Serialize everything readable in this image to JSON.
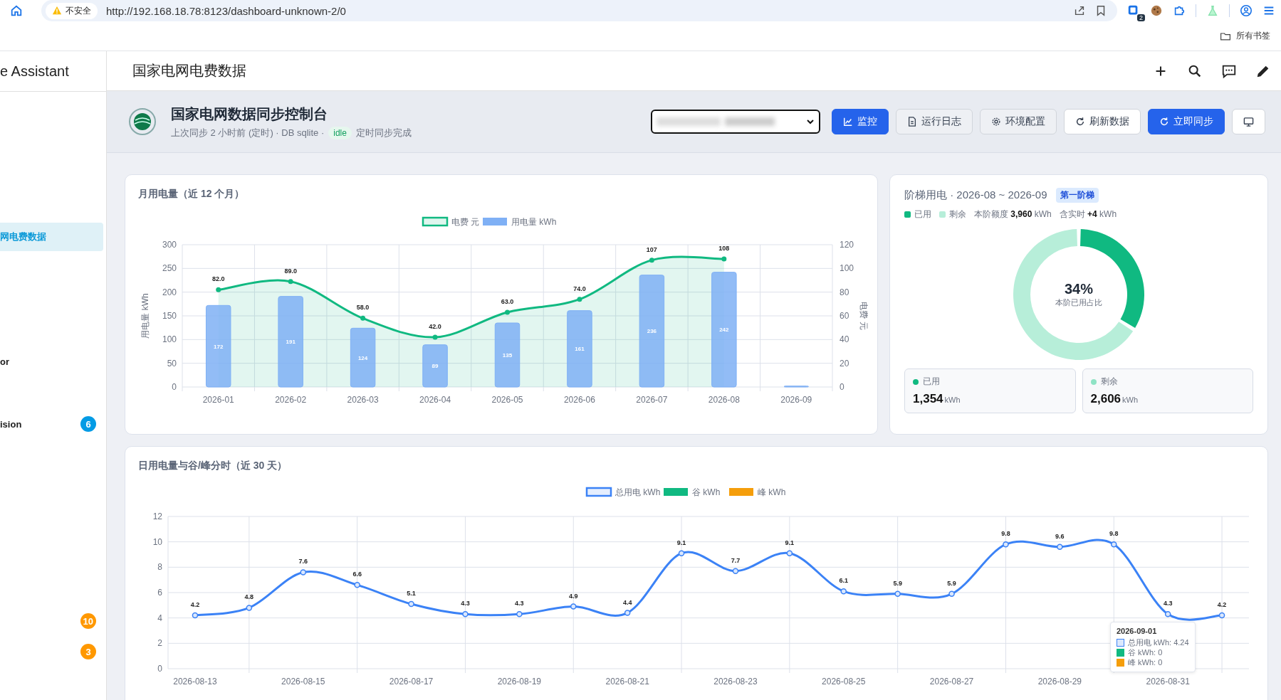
{
  "browser": {
    "security_label": "不安全",
    "url": "http://192.168.18.78:8123/dashboard-unknown-2/0",
    "extension_badge": "2",
    "bookmarks_label": "所有书签"
  },
  "sidebar": {
    "title": "e Assistant",
    "items": [
      {
        "label": "网电费数据",
        "selected": true
      },
      {
        "label": "or",
        "selected": false
      },
      {
        "label": "ision",
        "selected": false,
        "badge": "6",
        "color": "#039be5"
      },
      {
        "selected": false,
        "badge": "10",
        "color": "#ff9800"
      },
      {
        "selected": false,
        "badge": "3",
        "color": "#ff9800"
      }
    ]
  },
  "header": {
    "title": "国家电网电费数据"
  },
  "sync_panel": {
    "title": "国家电网数据同步控制台",
    "subtitle": "上次同步 2 小时前 (定时) · DB sqlite ·",
    "status": "idle",
    "status_text": "定时同步完成",
    "buttons": [
      {
        "label": "监控",
        "kind": "primary"
      },
      {
        "label": "运行日志",
        "kind": "muted"
      },
      {
        "label": "环境配置",
        "kind": "muted"
      },
      {
        "label": "刷新数据",
        "kind": "plain"
      },
      {
        "label": "立即同步",
        "kind": "primary"
      },
      {
        "kind": "plain"
      }
    ]
  },
  "monthly": {
    "title": "月用电量（近 12 个月）",
    "chart_data": {
      "type": "bar",
      "categories": [
        "2026-01",
        "2026-02",
        "2026-03",
        "2026-04",
        "2026-05",
        "2026-06",
        "2026-07",
        "2026-08",
        "2026-09"
      ],
      "series": [
        {
          "name": "电费 元",
          "color": "#10b981",
          "type": "area",
          "marker": true,
          "axis": "y2",
          "values": [
            82,
            89,
            58,
            42,
            63,
            74,
            107,
            108,
            null
          ],
          "value_labels": [
            "82.0",
            "89.0",
            "58.0",
            "42.0",
            "63.0",
            "74.0",
            "107",
            "108",
            null
          ]
        },
        {
          "name": "用电量 kWh",
          "color": "#7fb0f5",
          "type": "bar",
          "values": [
            172,
            191,
            124,
            89,
            135,
            161,
            236,
            242,
            2
          ],
          "value_labels": [
            "172",
            "191",
            "124",
            "89",
            "135",
            "161",
            "236",
            "242",
            null
          ]
        }
      ],
      "grid": true,
      "legend": "top",
      "ylabel": "用电量 kWh",
      "y2label": "电费 元",
      "ylim": [
        0,
        300
      ],
      "y2lim": [
        0,
        120
      ],
      "yticks": [
        0,
        50,
        100,
        150,
        200,
        250,
        300
      ],
      "y2ticks": [
        0,
        20,
        40,
        60,
        80,
        100,
        120
      ]
    }
  },
  "tier": {
    "title": "阶梯用电 · 2026-08 ~ 2026-09",
    "badge": "第一阶梯",
    "quota_text": "本阶额度 **3,960** kWh",
    "realtime_text": "含实时 **+4** kWh",
    "chart_data": {
      "type": "donut",
      "categories": [
        "已用",
        "剩余"
      ],
      "values": [
        34,
        66
      ],
      "colors": [
        "#10b981",
        "#b7eed9"
      ]
    },
    "center_value": "34%",
    "center_label": "本阶已用占比",
    "stats": [
      {
        "label": "已用",
        "value": "1,354",
        "unit": "kWh",
        "color": "#10b981"
      },
      {
        "label": "剩余",
        "value": "2,606",
        "unit": "kWh",
        "color": "#8fe3c5"
      }
    ]
  },
  "daily": {
    "title": "日用电量与谷/峰分时（近 30 天）",
    "chart_data": {
      "type": "line",
      "categories": [
        "2026-08-13",
        null,
        "2026-08-15",
        null,
        "2026-08-17",
        null,
        "2026-08-19",
        null,
        "2026-08-21",
        null,
        "2026-08-23",
        null,
        "2026-08-25",
        null,
        "2026-08-27",
        null,
        "2026-08-29",
        null,
        "2026-08-31",
        null
      ],
      "grid": true,
      "legend": "top",
      "series": [
        {
          "name": "总用电 kWh",
          "color": "#3b82f6",
          "marker": true,
          "values": [
            4.2,
            4.8,
            7.6,
            6.6,
            5.1,
            4.3,
            4.3,
            4.9,
            4.4,
            9.1,
            7.7,
            9.1,
            6.1,
            5.9,
            5.9,
            9.8,
            9.6,
            9.8,
            4.3,
            4.2
          ]
        },
        {
          "name": "谷 kWh",
          "color": "#10b981",
          "values": [
            null,
            null,
            null,
            null,
            null,
            null,
            null,
            null,
            null,
            null,
            null,
            null,
            null,
            null,
            null,
            null,
            null,
            null,
            null,
            null
          ]
        },
        {
          "name": "峰 kWh",
          "color": "#f59e0b",
          "values": [
            null,
            null,
            null,
            null,
            null,
            null,
            null,
            null,
            null,
            null,
            null,
            null,
            null,
            null,
            null,
            null,
            null,
            null,
            null,
            null
          ]
        }
      ],
      "ylim": [
        0,
        12
      ],
      "yticks": [
        0,
        2,
        4,
        6,
        8,
        10,
        12
      ],
      "data_labels": true
    },
    "tooltip": {
      "title": "2026-09-01",
      "lines": [
        "总用电 kWh: 4.24",
        "谷 kWh: 0",
        "峰 kWh: 0"
      ]
    }
  }
}
